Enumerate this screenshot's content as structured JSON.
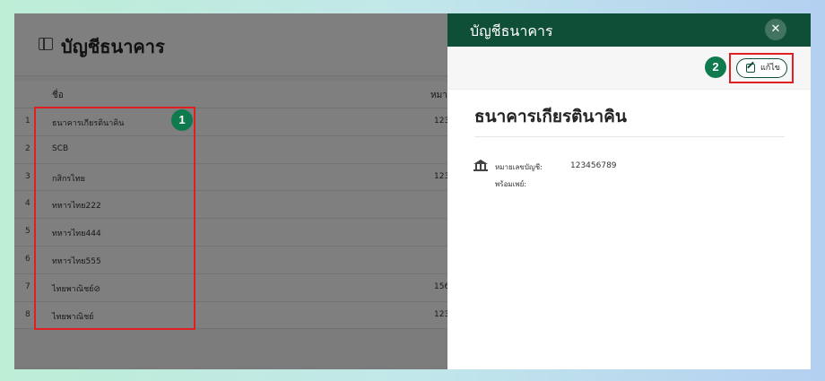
{
  "page": {
    "title": "บัญชีธนาคาร",
    "columns": {
      "name": "ชื่อ",
      "number": "หมา"
    },
    "rows": [
      {
        "idx": "1",
        "name": "ธนาคารเกียรตินาคิน",
        "number": "123"
      },
      {
        "idx": "2",
        "name": "SCB",
        "number": ""
      },
      {
        "idx": "3",
        "name": "กสิกรไทย",
        "number": "123"
      },
      {
        "idx": "4",
        "name": "ทหารไทย222",
        "number": ""
      },
      {
        "idx": "5",
        "name": "ทหารไทย444",
        "number": ""
      },
      {
        "idx": "6",
        "name": "ทหารไทย555",
        "number": ""
      },
      {
        "idx": "7",
        "name": "ไทยพาณิชย์⊘",
        "number": "156"
      },
      {
        "idx": "8",
        "name": "ไทยพาณิชย์",
        "number": "123"
      }
    ]
  },
  "drawer": {
    "title": "บัญชีธนาคาร",
    "close_icon": "✕",
    "edit_label": "แก้ไข",
    "bank_name": "ธนาคารเกียรตินาคิน",
    "account_label": "หมายเลขบัญชี:",
    "account_value": "123456789",
    "promptpay_label": "พร้อมเพย์:"
  },
  "annotations": {
    "badge1": "1",
    "badge2": "2"
  },
  "colors": {
    "header_green": "#0f4e37",
    "badge_green": "#0f7a4e",
    "highlight_red": "#e02020"
  },
  "icons": [
    "sidebar-panel-icon",
    "close-icon",
    "edit-icon",
    "bank-icon"
  ]
}
